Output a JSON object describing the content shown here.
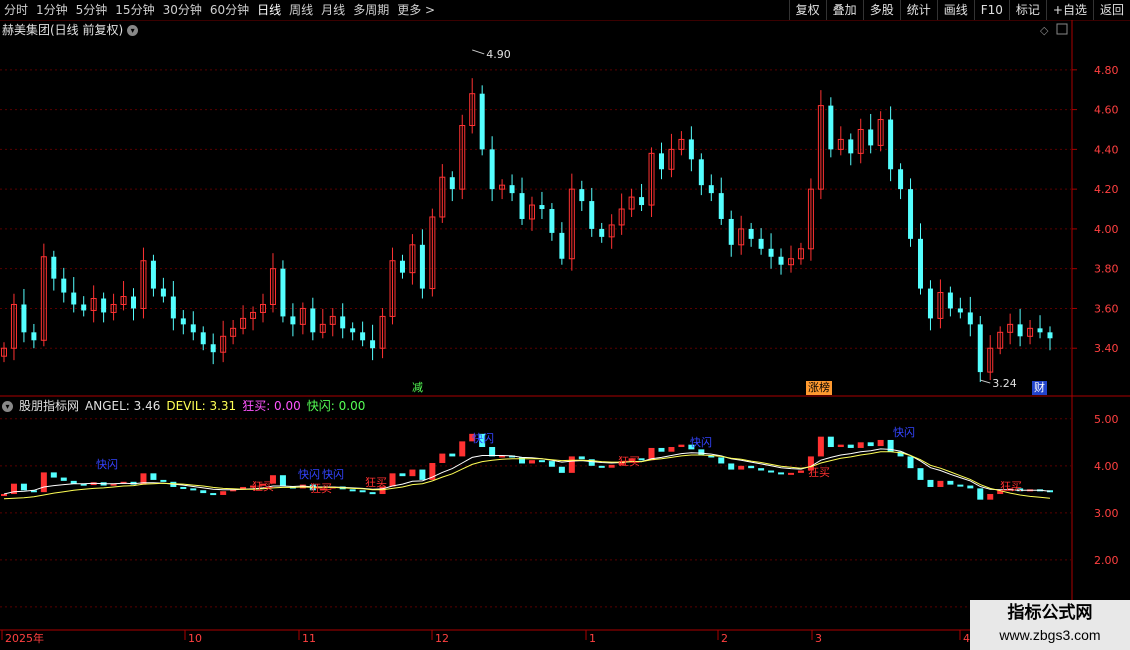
{
  "toolbar": {
    "periods": [
      "分时",
      "1分钟",
      "5分钟",
      "15分钟",
      "30分钟",
      "60分钟",
      "日线",
      "周线",
      "月线",
      "多周期",
      "更多 >"
    ],
    "active_period": "日线",
    "right_buttons": [
      "复权",
      "叠加",
      "多股",
      "统计",
      "画线",
      "F10",
      "标记",
      "+自选",
      "返回"
    ]
  },
  "main_chart": {
    "title": "赫美集团(日线 前复权)",
    "high_label": "4.90",
    "low_label": "3.24",
    "y_ticks": [
      "4.80",
      "4.60",
      "4.40",
      "4.20",
      "4.00",
      "3.80",
      "3.60",
      "3.40"
    ],
    "y_values": [
      4.8,
      4.6,
      4.4,
      4.2,
      4.0,
      3.8,
      3.6,
      3.4
    ],
    "marker_reduce": "减",
    "marker_limit": "涨榜",
    "marker_fin": "财",
    "colors": {
      "up": "#ff3232",
      "down": "#54ffff",
      "grid": "#5a0000"
    }
  },
  "indicator": {
    "name": "股朋指标网",
    "angel_label": "ANGEL: 3.46",
    "devil_label": "DEVIL: 3.31",
    "kuangmai_label": "狂买: 0.00",
    "kuaishan_label": "快闪: 0.00",
    "y_ticks": [
      "5.00",
      "4.00",
      "3.00",
      "2.00",
      "1.00"
    ],
    "y_values": [
      5.0,
      4.0,
      3.0,
      2.0,
      1.0
    ],
    "tag_buy": "狂买",
    "tag_flash": "快闪"
  },
  "xaxis": {
    "labels": [
      "2025年",
      "10",
      "11",
      "12",
      "1",
      "2",
      "3",
      "4"
    ]
  },
  "chart_data": {
    "type": "candlestick",
    "title": "赫美集团(日线 前复权)",
    "series": [
      {
        "name": "price_close_approx",
        "values": [
          3.4,
          3.62,
          3.48,
          3.44,
          3.86,
          3.75,
          3.68,
          3.62,
          3.59,
          3.65,
          3.58,
          3.62,
          3.66,
          3.6,
          3.84,
          3.7,
          3.66,
          3.55,
          3.52,
          3.48,
          3.42,
          3.38,
          3.46,
          3.5,
          3.55,
          3.58,
          3.62,
          3.8,
          3.56,
          3.52,
          3.6,
          3.48,
          3.52,
          3.56,
          3.5,
          3.48,
          3.44,
          3.4,
          3.56,
          3.84,
          3.78,
          3.92,
          3.7,
          4.06,
          4.26,
          4.2,
          4.52,
          4.68,
          4.4,
          4.2,
          4.22,
          4.18,
          4.05,
          4.12,
          4.1,
          3.98,
          3.85,
          4.2,
          4.14,
          4.0,
          3.96,
          4.02,
          4.1,
          4.16,
          4.12,
          4.38,
          4.3,
          4.4,
          4.45,
          4.35,
          4.22,
          4.18,
          4.05,
          3.92,
          4.0,
          3.95,
          3.9,
          3.86,
          3.82,
          3.85,
          3.9,
          4.2,
          4.62,
          4.4,
          4.45,
          4.38,
          4.5,
          4.42,
          4.55,
          4.3,
          4.2,
          3.95,
          3.7,
          3.55,
          3.68,
          3.6,
          3.58,
          3.52,
          3.28,
          3.4,
          3.48,
          3.52,
          3.46,
          3.5,
          3.48,
          3.45
        ]
      },
      {
        "name": "ANGEL",
        "values": [
          3.4,
          3.45,
          3.46,
          3.48,
          3.55,
          3.58,
          3.6,
          3.62,
          3.62,
          3.63,
          3.62,
          3.62,
          3.63,
          3.62,
          3.64,
          3.64,
          3.63,
          3.61,
          3.59,
          3.56,
          3.53,
          3.5,
          3.49,
          3.49,
          3.5,
          3.51,
          3.53,
          3.57,
          3.57,
          3.56,
          3.57,
          3.55,
          3.55,
          3.55,
          3.54,
          3.53,
          3.52,
          3.5,
          3.51,
          3.57,
          3.61,
          3.67,
          3.68,
          3.76,
          3.86,
          3.94,
          4.06,
          4.18,
          4.22,
          4.22,
          4.22,
          4.21,
          4.18,
          4.17,
          4.15,
          4.12,
          4.08,
          4.1,
          4.11,
          4.09,
          4.07,
          4.06,
          4.07,
          4.09,
          4.09,
          4.15,
          4.18,
          4.22,
          4.26,
          4.28,
          4.27,
          4.25,
          4.21,
          4.15,
          4.12,
          4.08,
          4.04,
          4.0,
          3.96,
          3.94,
          3.93,
          3.99,
          4.12,
          4.18,
          4.23,
          4.26,
          4.3,
          4.32,
          4.36,
          4.35,
          4.31,
          4.22,
          4.1,
          3.96,
          3.9,
          3.82,
          3.75,
          3.68,
          3.56,
          3.5,
          3.49,
          3.49,
          3.48,
          3.48,
          3.48,
          3.46
        ]
      },
      {
        "name": "DEVIL",
        "values": [
          3.3,
          3.31,
          3.32,
          3.34,
          3.38,
          3.42,
          3.45,
          3.48,
          3.5,
          3.52,
          3.53,
          3.55,
          3.57,
          3.58,
          3.61,
          3.62,
          3.63,
          3.62,
          3.61,
          3.59,
          3.57,
          3.54,
          3.52,
          3.51,
          3.5,
          3.5,
          3.51,
          3.53,
          3.54,
          3.54,
          3.55,
          3.54,
          3.54,
          3.54,
          3.53,
          3.52,
          3.51,
          3.49,
          3.49,
          3.52,
          3.55,
          3.6,
          3.62,
          3.68,
          3.76,
          3.83,
          3.93,
          4.03,
          4.09,
          4.12,
          4.14,
          4.15,
          4.15,
          4.15,
          4.15,
          4.13,
          4.11,
          4.12,
          4.12,
          4.11,
          4.09,
          4.08,
          4.08,
          4.09,
          4.09,
          4.13,
          4.15,
          4.18,
          4.21,
          4.23,
          4.23,
          4.22,
          4.2,
          4.16,
          4.14,
          4.1,
          4.07,
          4.03,
          3.99,
          3.97,
          3.95,
          3.98,
          4.06,
          4.11,
          4.16,
          4.19,
          4.23,
          4.26,
          4.3,
          4.3,
          4.28,
          4.22,
          4.13,
          4.01,
          3.95,
          3.87,
          3.79,
          3.71,
          3.6,
          3.52,
          3.47,
          3.42,
          3.38,
          3.35,
          3.33,
          3.31
        ]
      }
    ],
    "ylim": [
      3.2,
      4.95
    ]
  }
}
